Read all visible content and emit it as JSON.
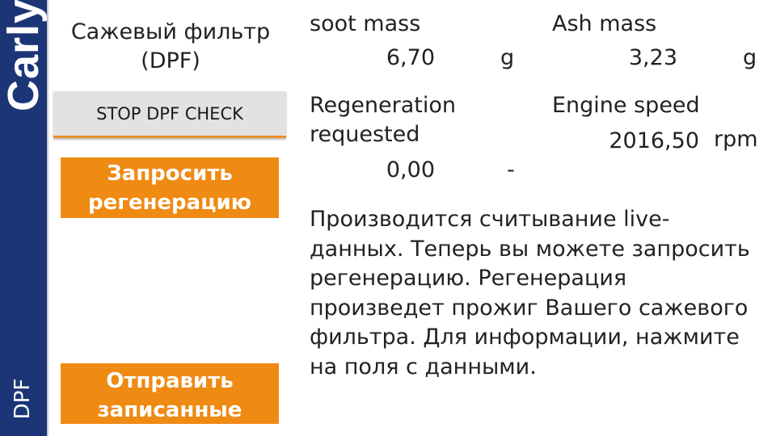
{
  "sidebar": {
    "logo_text": "Carly",
    "section_label": "DPF"
  },
  "feature": {
    "title_line1": "Сажевый фильтр",
    "title_line2": "(DPF)"
  },
  "buttons": {
    "stop_check": "STOP DPF CHECK",
    "request_regen_line1": "Запросить",
    "request_regen_line2": "регенерацию",
    "send_recorded_line1": "Отправить",
    "send_recorded_line2": "записанные"
  },
  "metrics": [
    {
      "label_lines": [
        "soot mass"
      ],
      "value": "6,70",
      "unit": "g"
    },
    {
      "label_lines": [
        "Ash mass"
      ],
      "value": "3,23",
      "unit": "g"
    },
    {
      "label_lines": [
        "Regeneration",
        "requested"
      ],
      "value": "0,00",
      "unit": "-"
    },
    {
      "label_lines": [
        "Engine speed"
      ],
      "value": "2016,50",
      "unit": "rpm"
    }
  ],
  "info": {
    "lines": [
      "Производится считывание live-",
      "данных. Теперь вы можете запросить",
      "регенерацию. Регенерация",
      "произведет прожиг Вашего сажевого",
      "фильтра. Для информации, нажмите",
      "на поля с данными."
    ]
  },
  "colors": {
    "sidebar": "#1c3576",
    "accent": "#ef8a13",
    "button_gray": "#e2e2e2"
  }
}
